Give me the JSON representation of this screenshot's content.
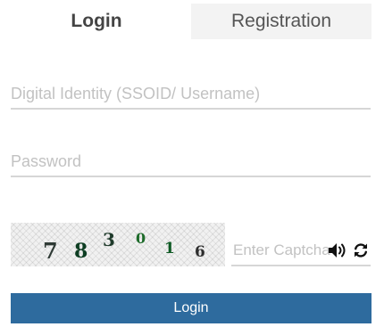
{
  "tabs": {
    "login": "Login",
    "registration": "Registration"
  },
  "form": {
    "username_placeholder": "Digital Identity (SSOID/ Username)",
    "username_value": "",
    "password_placeholder": "Password",
    "password_value": "",
    "captcha_chars": [
      "7",
      "8",
      "3",
      "0",
      "1",
      "6"
    ],
    "captcha_placeholder": "Enter Captcha",
    "captcha_value": "",
    "login_button": "Login"
  },
  "icons": {
    "audio": "speaker-icon",
    "refresh": "refresh-icon"
  },
  "colors": {
    "primary_button": "#2e6b9e",
    "inactive_tab_bg": "#f3f3f3",
    "placeholder": "#c2c2c2",
    "field_underline": "#d6d6d6"
  }
}
